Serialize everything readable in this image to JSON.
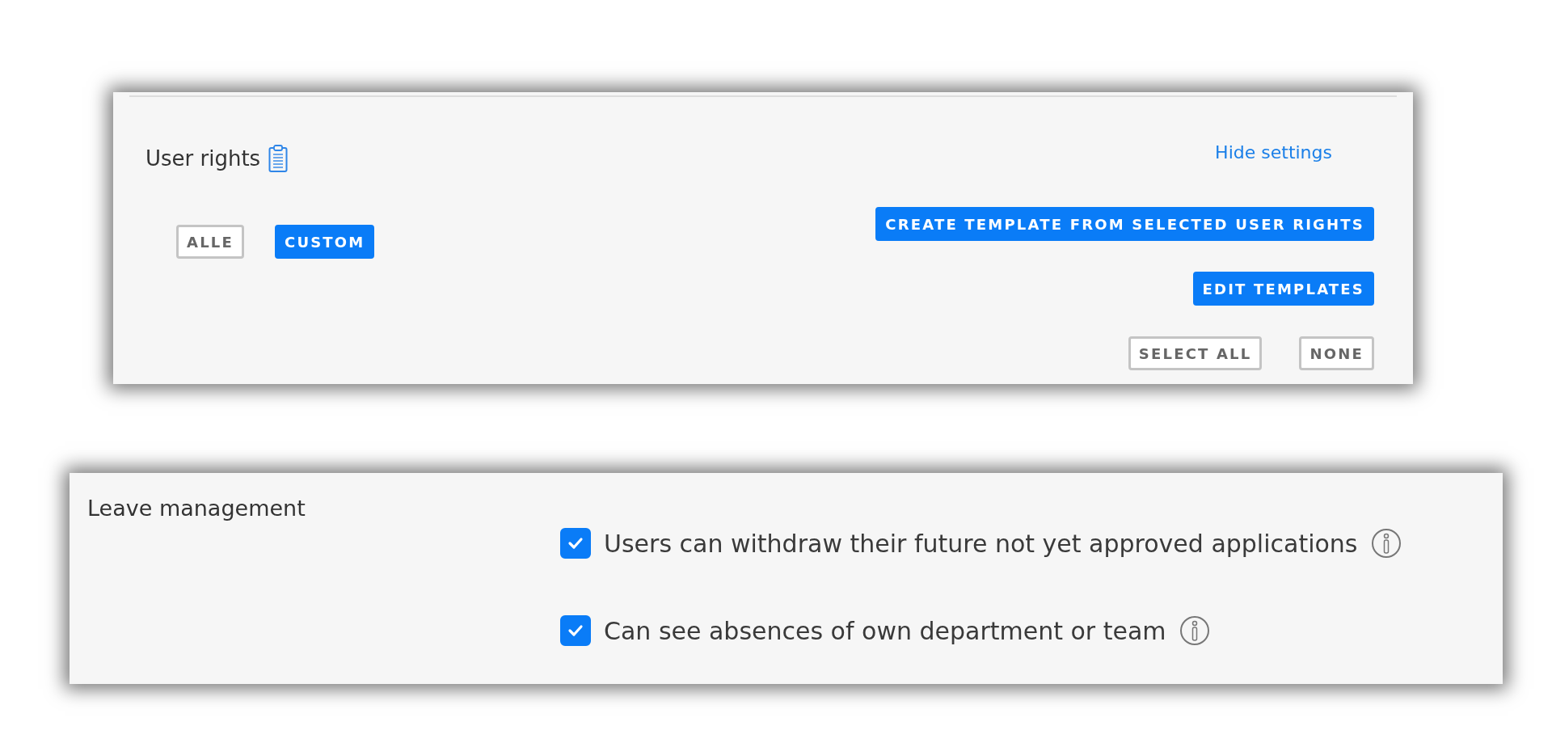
{
  "user_rights": {
    "title": "User rights",
    "hide_link": "Hide settings",
    "modes": [
      {
        "label": "ALLE",
        "selected": false
      },
      {
        "label": "CUSTOM",
        "selected": true
      }
    ],
    "template_actions": [
      "CREATE TEMPLATE FROM SELECTED USER RIGHTS",
      "EDIT TEMPLATES"
    ],
    "selection_actions": [
      "SELECT ALL",
      "NONE"
    ]
  },
  "leave_management": {
    "title": "Leave management",
    "options": [
      {
        "label": "Users can withdraw their future not yet approved applications",
        "checked": true
      },
      {
        "label": "Can see absences of own department or team",
        "checked": true
      }
    ]
  }
}
